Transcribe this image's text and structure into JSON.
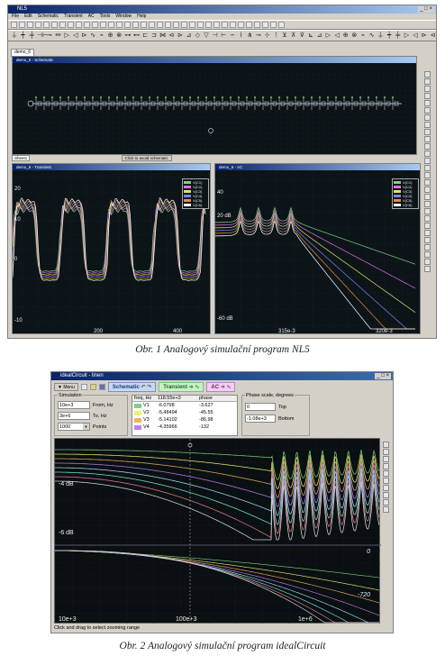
{
  "fig1": {
    "app_title": "NL5",
    "menu": [
      "File",
      "Edit",
      "Schematic",
      "Transient",
      "AC",
      "Tools",
      "Window",
      "Help"
    ],
    "tab": "demo_6",
    "schematic_title": "demo_6 - Schematic",
    "sheet_tab": "Sheet1",
    "status_hint": "Click to avoid schematic",
    "transient_title": "demo_6 - Transient",
    "ac_title": "demo_6 - AC",
    "transient_legend": [
      "V(C1)",
      "V(C2)",
      "V(C3)",
      "V(C4)",
      "V(C5)",
      "V(C6)"
    ],
    "ac_legend": [
      "V(C1)",
      "V(C2)",
      "V(C3)",
      "V(C4)",
      "V(C5)",
      "V(C6)"
    ],
    "transient_y_ticks": [
      "20",
      "10",
      "0",
      "-10"
    ],
    "transient_x_ticks": [
      "200",
      "400"
    ],
    "ac_y_ticks": [
      "40",
      "20 dB",
      "-60 dB"
    ],
    "ac_x_ticks": [
      "315e-3",
      "320e-3"
    ],
    "legend_colors": [
      "#7fd27f",
      "#e070e0",
      "#e0e060",
      "#8080f0",
      "#e09040",
      "#ffffff"
    ],
    "caption": "Obr. 1  Analogový simulační program NL5"
  },
  "fig2": {
    "app_title": "idealCircuit - linen",
    "menu_btn": "Menu",
    "tab_schematic": "Schematic",
    "tab_transient": "Transient",
    "tab_ac": "AC",
    "sim_label": "Simulation",
    "from_value": "10e+3",
    "from_label": "From, Hz",
    "to_value": "3e+6",
    "to_label": "To, Hz",
    "points_value": "1000",
    "points_label": "Points",
    "table_headers": [
      "freq, Hz",
      "118.55e+3",
      "phase"
    ],
    "table_rows": [
      {
        "name": "V1",
        "mag": "-6.0798",
        "phase": "-3.627",
        "color": "#80d080"
      },
      {
        "name": "V2",
        "mag": "-5.48494",
        "phase": "-45.55",
        "color": "#f0f070"
      },
      {
        "name": "V3",
        "mag": "-5.14102",
        "phase": "-86.98",
        "color": "#f0b060"
      },
      {
        "name": "V4",
        "mag": "-4.35966",
        "phase": "-132",
        "color": "#c080f0"
      }
    ],
    "phase_label": "Phase scale, degrees",
    "phase_top": "0",
    "phase_top_label": "Top",
    "phase_bottom": "-1.08e+3",
    "phase_bottom_label": "Bottom",
    "mag_ticks": [
      "-4 dB",
      "-6 dB"
    ],
    "phase_ticks": [
      "0",
      "-720"
    ],
    "x_ticks": [
      "10e+3",
      "100e+3",
      "1e+6"
    ],
    "status": "Click and drag to select zooming range",
    "caption": "Obr. 2  Analogový simulační program idealCircuit"
  }
}
